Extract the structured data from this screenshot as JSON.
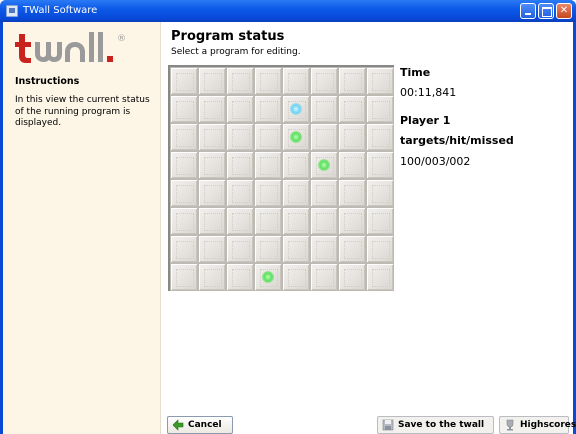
{
  "window": {
    "title": "TWall Software"
  },
  "sidebar": {
    "logo_text": "twall",
    "registered_mark": "®",
    "heading": "Instructions",
    "text": "In this view the current status of the running program is displayed."
  },
  "main": {
    "title": "Program status",
    "subtitle": "Select a program for editing."
  },
  "status": {
    "time_label": "Time",
    "time_value": "00:11,841",
    "player_label": "Player 1",
    "stats_label": "targets/hit/missed",
    "stats_value": "100/003/002"
  },
  "grid": {
    "rows": 8,
    "cols": 8,
    "lit_cells": [
      {
        "row": 1,
        "col": 4,
        "color": "cyan"
      },
      {
        "row": 2,
        "col": 4,
        "color": "green"
      },
      {
        "row": 3,
        "col": 5,
        "color": "green"
      },
      {
        "row": 7,
        "col": 3,
        "color": "green"
      }
    ]
  },
  "buttons": {
    "cancel": "Cancel",
    "save": "Save to the twall",
    "highscores": "Highscores"
  },
  "colors": {
    "title_bar": "#0c5ae8",
    "sidebar_bg": "#fdf5e6",
    "green_light": "#5fe05f",
    "cyan_light": "#6fd4f4",
    "logo_red": "#c8231c"
  }
}
